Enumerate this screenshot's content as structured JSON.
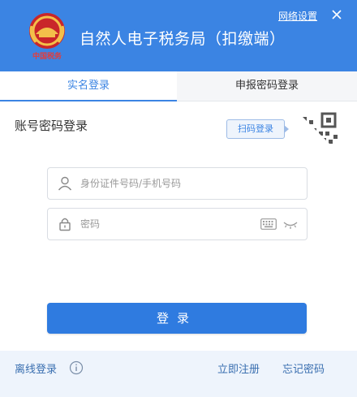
{
  "header": {
    "title": "自然人电子税务局（扣缴端）",
    "network_settings": "网络设置",
    "logo_text": "中国税务",
    "brand_color": "#3b84e3"
  },
  "tabs": [
    {
      "label": "实名登录",
      "active": true
    },
    {
      "label": "申报密码登录",
      "active": false
    }
  ],
  "form": {
    "title": "账号密码登录",
    "scan_label": "扫码登录",
    "id_field": {
      "placeholder": "身份证件号码/手机号码",
      "value": ""
    },
    "password_field": {
      "placeholder": "密码",
      "value": ""
    },
    "login_label": "登录"
  },
  "footer": {
    "offline_login": "离线登录",
    "register": "立即注册",
    "forgot_password": "忘记密码"
  },
  "icons": [
    "tax-emblem-icon",
    "close-icon",
    "qr-code-icon",
    "user-icon",
    "lock-icon",
    "keyboard-icon",
    "eye-closed-icon",
    "info-icon"
  ]
}
